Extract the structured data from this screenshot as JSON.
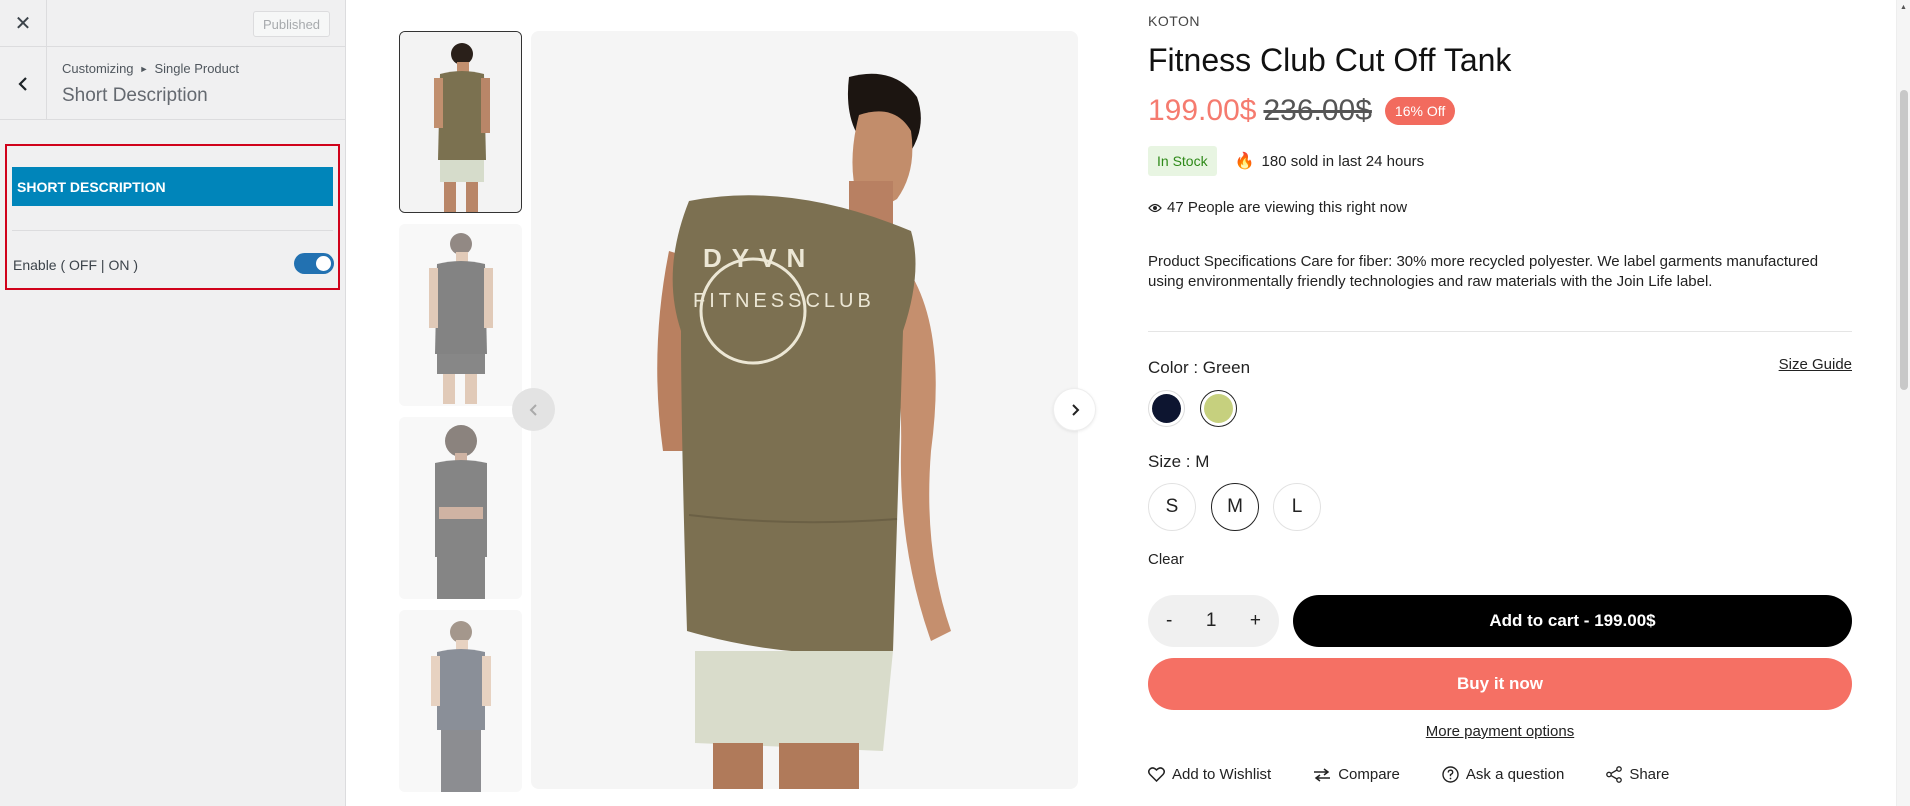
{
  "customizer": {
    "close_icon": "close-icon",
    "published_label": "Published",
    "breadcrumb_root": "Customizing",
    "breadcrumb_parent": "Single Product",
    "section_title": "Short Description",
    "control_heading": "SHORT DESCRIPTION",
    "enable_label": "Enable ( OFF | ON )",
    "enable_state": true
  },
  "gallery": {
    "thumbnail_count": 4,
    "active_thumbnail": 1
  },
  "product": {
    "brand": "KOTON",
    "title": "Fitness Club Cut Off Tank",
    "price_sale": "199.00$",
    "price_regular": "236.00$",
    "discount_badge": "16% Off",
    "stock_status": "In Stock",
    "sold_text": "180 sold in last 24 hours",
    "viewing_text": "47 People are viewing this right now",
    "description": "Product Specifications Care for fiber: 30% more recycled polyester. We label garments manufactured using environmentally friendly technologies and raw materials with the Join Life label.",
    "color_label": "Color : ",
    "color_value": "Green",
    "size_guide": "Size Guide",
    "colors": [
      {
        "name": "Navy",
        "hex": "#0d1530"
      },
      {
        "name": "Green",
        "hex": "#c6d07e"
      }
    ],
    "size_label": "Size : M",
    "sizes": [
      "S",
      "M",
      "L"
    ],
    "selected_size": "M",
    "clear_label": "Clear",
    "qty_minus": "-",
    "quantity": "1",
    "qty_plus": "+",
    "add_to_cart": "Add to cart - 199.00$",
    "buy_now": "Buy it now",
    "more_payment": "More payment options",
    "actions": {
      "wishlist": "Add to Wishlist",
      "compare": "Compare",
      "ask": "Ask a question",
      "share": "Share"
    }
  },
  "colors": {
    "accent_blue": "#0085ba",
    "toggle_blue": "#2271b1",
    "sale_red": "#f57b6f",
    "buy_now_bg": "#f57064",
    "highlight_border": "#d0021b"
  }
}
